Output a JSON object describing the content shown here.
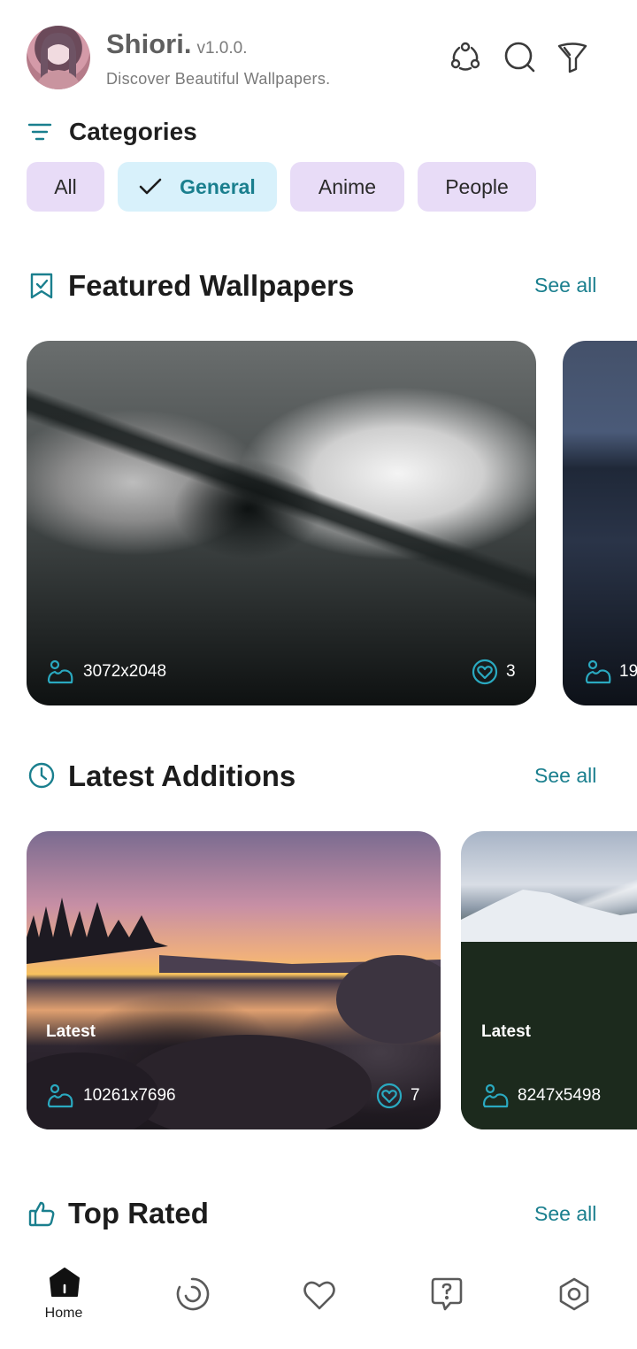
{
  "header": {
    "title": "Shiori.",
    "version": "v1.0.0.",
    "tagline": "Discover Beautiful Wallpapers.",
    "icons": [
      "share-icon",
      "search-icon",
      "filter-icon"
    ]
  },
  "categories": {
    "title": "Categories",
    "chips": [
      {
        "label": "All",
        "selected": false
      },
      {
        "label": "General",
        "selected": true
      },
      {
        "label": "Anime",
        "selected": false
      },
      {
        "label": "People",
        "selected": false
      }
    ]
  },
  "featured": {
    "title": "Featured Wallpapers",
    "see_all": "See all",
    "cards": [
      {
        "resolution": "3072x2048",
        "likes": "3"
      },
      {
        "resolution": "19",
        "likes": ""
      }
    ]
  },
  "latest": {
    "title": "Latest Additions",
    "see_all": "See all",
    "cards": [
      {
        "tag": "Latest",
        "resolution": "10261x7696",
        "likes": "7"
      },
      {
        "tag": "Latest",
        "resolution": "8247x5498",
        "likes": ""
      }
    ]
  },
  "top_rated": {
    "title": "Top Rated",
    "see_all": "See all"
  },
  "bottom_nav": {
    "items": [
      {
        "label": "Home",
        "icon": "home-icon",
        "active": true
      },
      {
        "label": "",
        "icon": "explore-icon",
        "active": false
      },
      {
        "label": "",
        "icon": "heart-icon",
        "active": false
      },
      {
        "label": "",
        "icon": "help-icon",
        "active": false
      },
      {
        "label": "",
        "icon": "settings-icon",
        "active": false
      }
    ]
  },
  "colors": {
    "accent": "#1a7f8e",
    "chip_bg": "#e8dcf7",
    "chip_selected_bg": "#d8f1fb"
  }
}
